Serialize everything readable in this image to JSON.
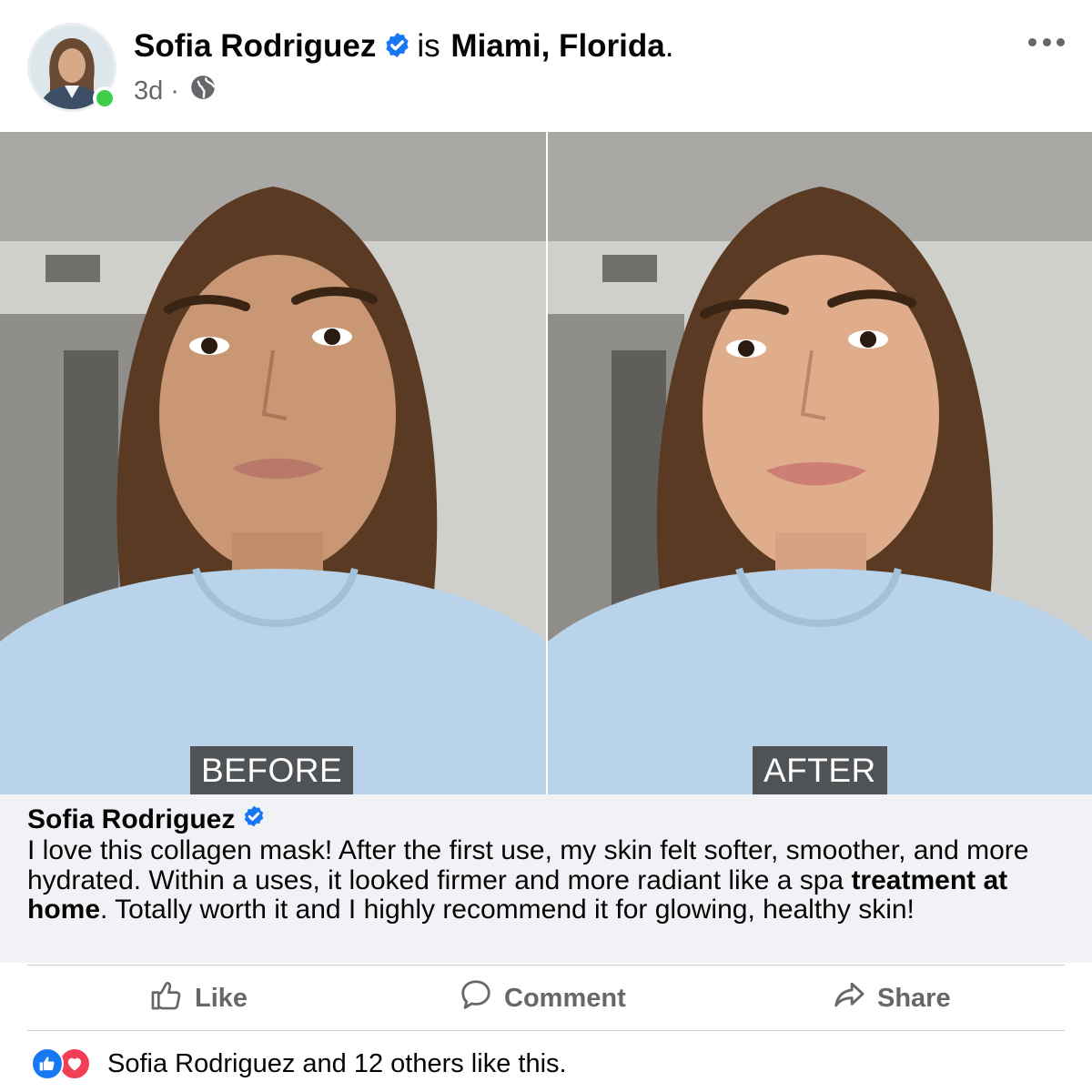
{
  "post": {
    "author_name": "Sofia Rodriguez",
    "verified": true,
    "connector": "is",
    "location": "Miami, Florida",
    "location_punct": ".",
    "time": "3d",
    "separator": "·",
    "privacy_icon": "globe-icon",
    "menu_icon": "more-horizontal-icon",
    "online": true
  },
  "photos": {
    "before_label": "BEFORE",
    "after_label": "AFTER"
  },
  "caption": {
    "author_name": "Sofia Rodriguez",
    "text_part1": "I love this collagen mask! After the first use, my skin felt softer, smoother, and more hydrated. Within a uses, it looked firmer and more radiant like a spa ",
    "text_bold": "treatment at home",
    "text_part2": ". Totally worth it and I highly recommend it for glowing, healthy skin!"
  },
  "actions": {
    "like_label": "Like",
    "comment_label": "Comment",
    "share_label": "Share"
  },
  "reactions": {
    "summary": "Sofia Rodriguez and 12 others like this.",
    "icons": [
      "like-reaction-icon",
      "love-reaction-icon"
    ]
  },
  "colors": {
    "verified_blue": "#1877f2",
    "online_green": "#3ecf4a",
    "secondary_text": "#65676b",
    "caption_bg": "#f0f2f5",
    "love_red": "#f33e58"
  }
}
